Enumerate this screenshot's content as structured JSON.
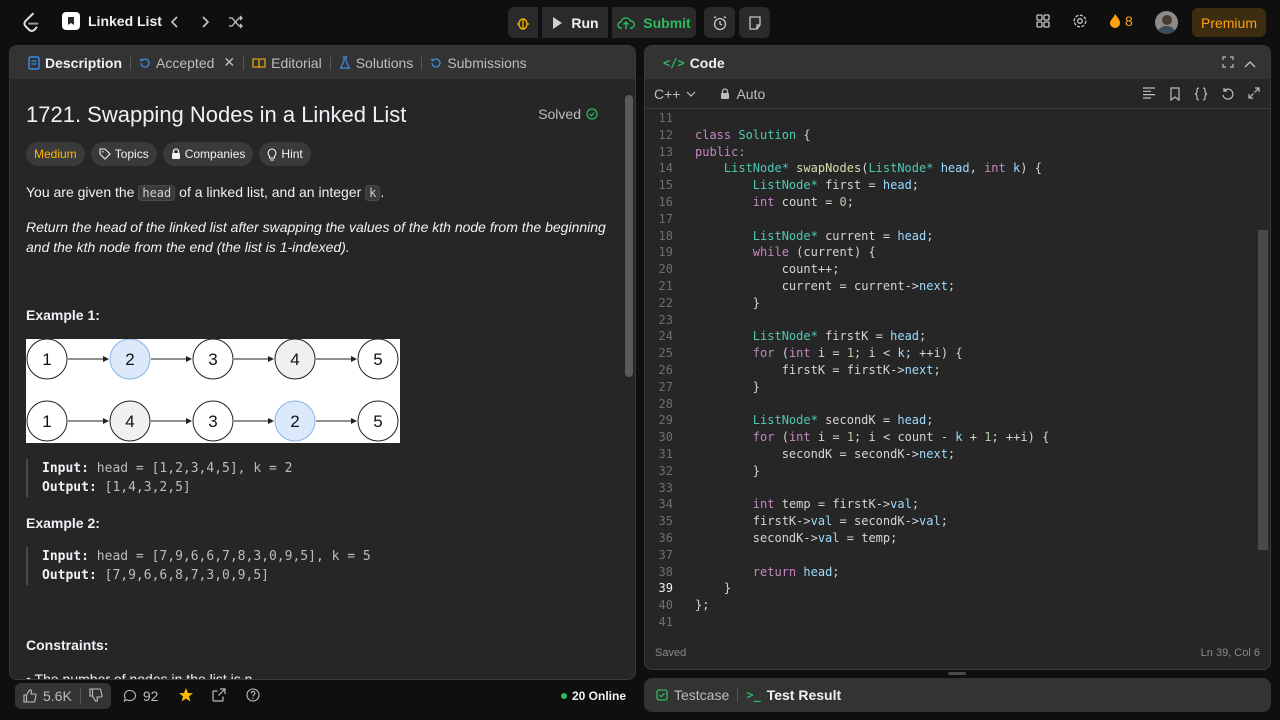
{
  "nav": {
    "problem_list": "Linked List",
    "run": "Run",
    "submit": "Submit",
    "streak": "8",
    "premium": "Premium"
  },
  "desc_tabs": [
    {
      "label": "Description"
    },
    {
      "label": "Accepted"
    },
    {
      "label": "Editorial"
    },
    {
      "label": "Solutions"
    },
    {
      "label": "Submissions"
    }
  ],
  "problem": {
    "title": "1721. Swapping Nodes in a Linked List",
    "solved": "Solved",
    "tags": [
      "Medium",
      "Topics",
      "Companies",
      "Hint"
    ],
    "p1_a": "You are given the ",
    "p1_code1": "head",
    "p1_b": " of a linked list, and an integer ",
    "p1_code2": "k",
    "p1_c": ".",
    "p2": "Return the head of the linked list after swapping the values of the kth node from the beginning and the kth node from the end (the list is 1-indexed).",
    "ex1_title": "Example 1:",
    "ex1_input": "head = [1,2,3,4,5], k = 2",
    "ex1_output": "[1,4,3,2,5]",
    "ex2_title": "Example 2:",
    "ex2_input": "head = [7,9,6,6,7,8,3,0,9,5], k = 5",
    "ex2_output": "[7,9,6,6,8,7,3,0,9,5]",
    "input_label": "Input:",
    "output_label": "Output:",
    "constraints_title": "Constraints:",
    "constraint1": "The number of nodes in the list is n",
    "list_row1": [
      "1",
      "2",
      "3",
      "4",
      "5"
    ],
    "list_row2": [
      "1",
      "4",
      "3",
      "2",
      "5"
    ]
  },
  "bottom": {
    "likes": "5.6K",
    "comments": "92",
    "online": "20 Online"
  },
  "code_panel": {
    "title": "Code",
    "lang": "C++",
    "mode": "Auto",
    "saved": "Saved",
    "cursor": "Ln 39, Col 6"
  },
  "test": {
    "testcase": "Testcase",
    "result": "Test Result"
  },
  "code_lines": [
    {
      "n": "11",
      "t": ""
    },
    {
      "n": "12",
      "t": "class Solution {"
    },
    {
      "n": "13",
      "t": "public:"
    },
    {
      "n": "14",
      "t": "    ListNode* swapNodes(ListNode* head, int k) {"
    },
    {
      "n": "15",
      "t": "        ListNode* first = head;"
    },
    {
      "n": "16",
      "t": "        int count = 0;"
    },
    {
      "n": "17",
      "t": ""
    },
    {
      "n": "18",
      "t": "        ListNode* current = head;"
    },
    {
      "n": "19",
      "t": "        while (current) {"
    },
    {
      "n": "20",
      "t": "            count++;"
    },
    {
      "n": "21",
      "t": "            current = current->next;"
    },
    {
      "n": "22",
      "t": "        }"
    },
    {
      "n": "23",
      "t": ""
    },
    {
      "n": "24",
      "t": "        ListNode* firstK = head;"
    },
    {
      "n": "25",
      "t": "        for (int i = 1; i < k; ++i) {"
    },
    {
      "n": "26",
      "t": "            firstK = firstK->next;"
    },
    {
      "n": "27",
      "t": "        }"
    },
    {
      "n": "28",
      "t": ""
    },
    {
      "n": "29",
      "t": "        ListNode* secondK = head;"
    },
    {
      "n": "30",
      "t": "        for (int i = 1; i < count - k + 1; ++i) {"
    },
    {
      "n": "31",
      "t": "            secondK = secondK->next;"
    },
    {
      "n": "32",
      "t": "        }"
    },
    {
      "n": "33",
      "t": ""
    },
    {
      "n": "34",
      "t": "        int temp = firstK->val;"
    },
    {
      "n": "35",
      "t": "        firstK->val = secondK->val;"
    },
    {
      "n": "36",
      "t": "        secondK->val = temp;"
    },
    {
      "n": "37",
      "t": ""
    },
    {
      "n": "38",
      "t": "        return head;"
    },
    {
      "n": "39",
      "t": "    }"
    },
    {
      "n": "40",
      "t": "};"
    },
    {
      "n": "41",
      "t": ""
    }
  ]
}
